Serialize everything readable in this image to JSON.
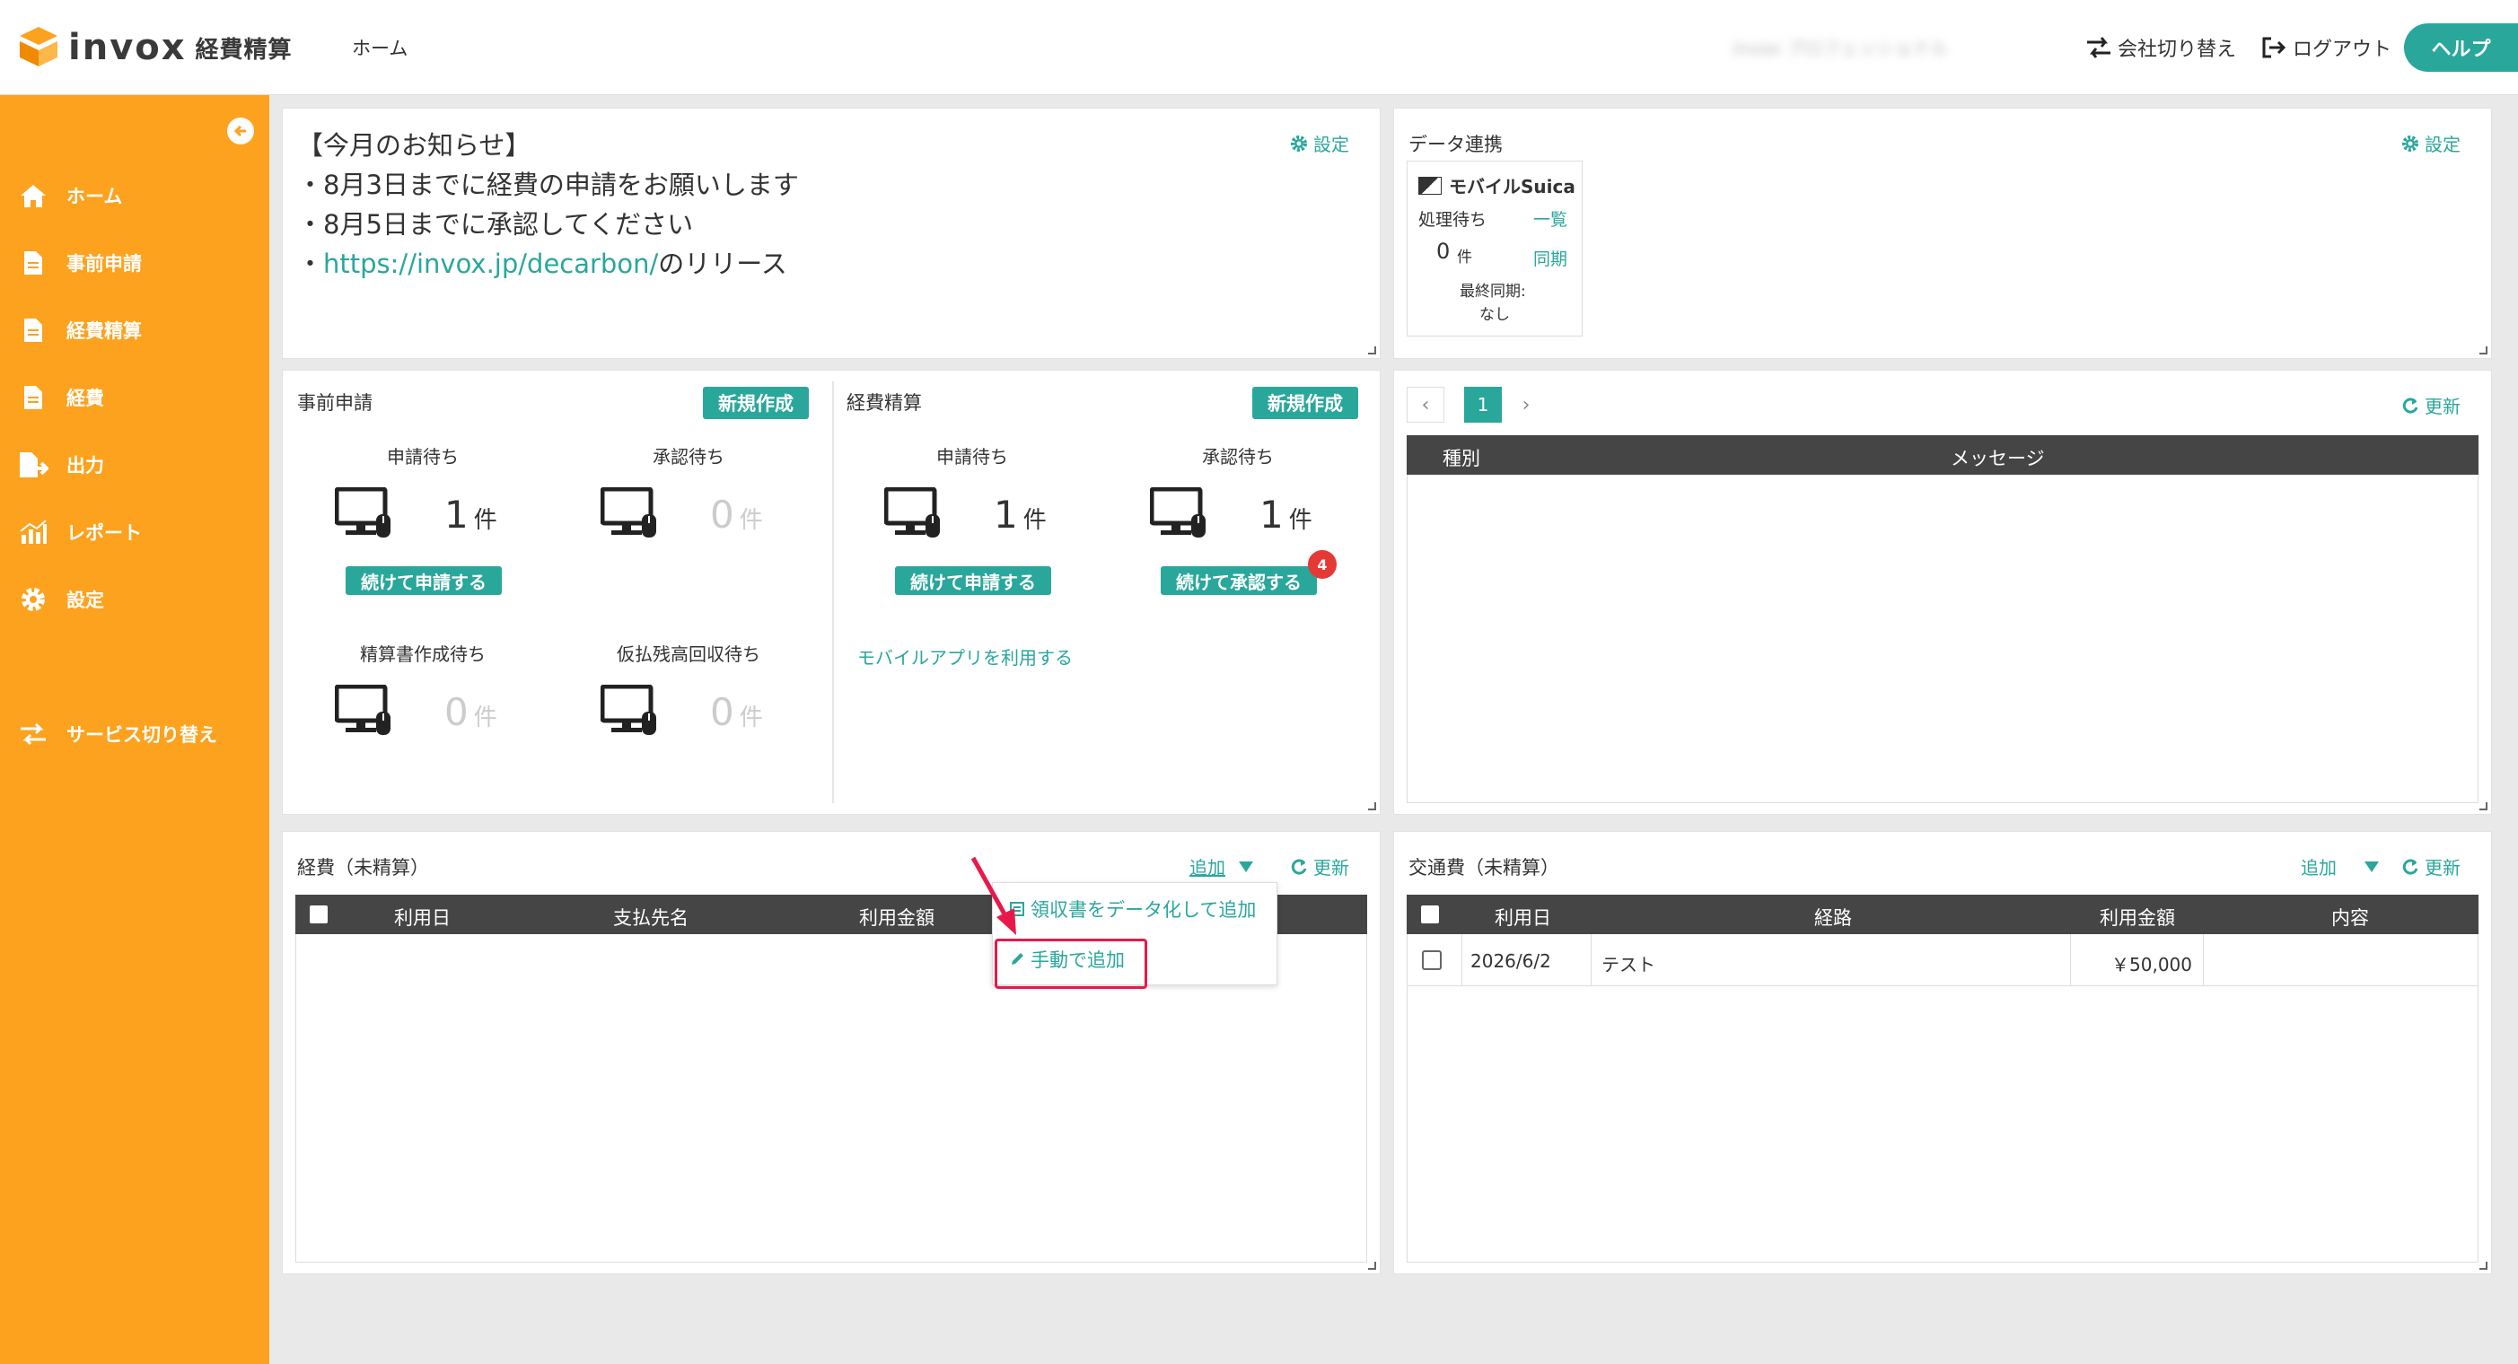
{
  "header": {
    "logo_text": "invox",
    "logo_sub": "経費精算",
    "nav_home": "ホーム",
    "user_name": "invox プロフェッショナル",
    "switch_company": "会社切り替え",
    "logout": "ログアウト",
    "help": "ヘルプ"
  },
  "sidebar": {
    "items": [
      {
        "label": "ホーム",
        "icon": "home-icon"
      },
      {
        "label": "事前申請",
        "icon": "document-icon"
      },
      {
        "label": "経費精算",
        "icon": "document-icon"
      },
      {
        "label": "経費",
        "icon": "document-icon"
      },
      {
        "label": "出力",
        "icon": "export-icon"
      },
      {
        "label": "レポート",
        "icon": "chart-icon"
      },
      {
        "label": "設定",
        "icon": "gear-icon"
      },
      {
        "label": "サービス切り替え",
        "icon": "switch-icon"
      }
    ]
  },
  "notice": {
    "title": "【今月のお知らせ】",
    "line1": "・8月3日までに経費の申請をお願いします",
    "line2": "・8月5日までに承認してください",
    "line3_prefix": "・",
    "line3_link": "https://invox.jp/decarbon/",
    "line3_suffix": "のリリース",
    "settings": "設定"
  },
  "data_link": {
    "title": "データ連携",
    "settings": "設定",
    "card_title": "モバイルSuica",
    "pending_label": "処理待ち",
    "list_link": "一覧",
    "pending_count": "0",
    "unit": "件",
    "sync_link": "同期",
    "last_sync_label": "最終同期:",
    "last_sync_value": "なし"
  },
  "pre_application": {
    "title": "事前申請",
    "new_button": "新規作成",
    "stats": [
      {
        "label": "申請待ち",
        "count": "1",
        "unit": "件"
      },
      {
        "label": "承認待ち",
        "count": "0",
        "unit": "件"
      },
      {
        "label": "精算書作成待ち",
        "count": "0",
        "unit": "件"
      },
      {
        "label": "仮払残高回収待ち",
        "count": "0",
        "unit": "件"
      }
    ],
    "continue_button": "続けて申請する"
  },
  "expense_settlement": {
    "title": "経費精算",
    "new_button": "新規作成",
    "stats": [
      {
        "label": "申請待ち",
        "count": "1",
        "unit": "件"
      },
      {
        "label": "承認待ち",
        "count": "1",
        "unit": "件"
      }
    ],
    "continue_apply": "続けて申請する",
    "continue_approve": "続けて承認する",
    "approve_badge": "4",
    "mobile_link": "モバイルアプリを利用する"
  },
  "messages": {
    "page": "1",
    "refresh": "更新",
    "columns": [
      "種別",
      "メッセージ"
    ]
  },
  "expenses": {
    "title": "経費（未精算）",
    "add": "追加",
    "refresh": "更新",
    "columns": [
      "利用日",
      "支払先名",
      "利用金額"
    ],
    "dropdown": {
      "item1": "領収書をデータ化して追加",
      "item2": "手動で追加"
    }
  },
  "transport": {
    "title": "交通費（未精算）",
    "add": "追加",
    "refresh": "更新",
    "columns": [
      "利用日",
      "経路",
      "利用金額",
      "内容"
    ],
    "rows": [
      {
        "date": "2026/6/2",
        "route": "テスト",
        "amount": "￥50,000",
        "content": ""
      }
    ]
  },
  "colors": {
    "accent": "#2aa79b",
    "sidebar": "#fca21e",
    "badge": "#e53935",
    "highlight": "#e8194a"
  }
}
